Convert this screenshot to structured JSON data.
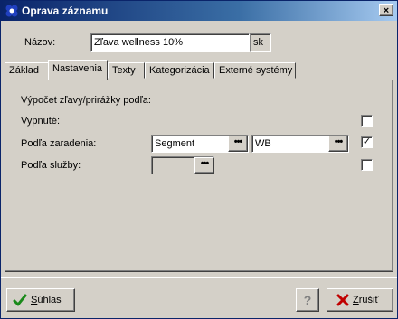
{
  "window": {
    "title": "Oprava záznamu",
    "close_label": "×"
  },
  "form": {
    "nazov_label": "Názov:",
    "nazov_value": "Zľava wellness 10%",
    "lang_code": "sk"
  },
  "tabs": [
    {
      "label": "Základ"
    },
    {
      "label": "Nastavenia"
    },
    {
      "label": "Texty"
    },
    {
      "label": "Kategorizácia"
    },
    {
      "label": "Externé systémy"
    }
  ],
  "active_tab": "Nastavenia",
  "settings": {
    "heading": "Výpočet zľavy/prirážky podľa:",
    "vypnute_label": "Vypnuté:",
    "vypnute_checked": false,
    "zaradenie_label": "Podľa zaradenia:",
    "zaradenie_value1": "Segment",
    "zaradenie_value2": "WB",
    "zaradenie_checked": true,
    "sluzba_label": "Podľa služby:",
    "sluzba_value": "",
    "sluzba_checked": false,
    "dots": "•••",
    "check_mark": "✓"
  },
  "buttons": {
    "ok_prefix": "S",
    "ok_rest": "úhlas",
    "help": "?",
    "cancel_prefix": "Z",
    "cancel_rest": "rušiť"
  },
  "colors": {
    "title_bar": "#0a246a",
    "face": "#d4d0c8",
    "ok_check": "#1a8a1a",
    "cancel_x": "#c00000"
  }
}
